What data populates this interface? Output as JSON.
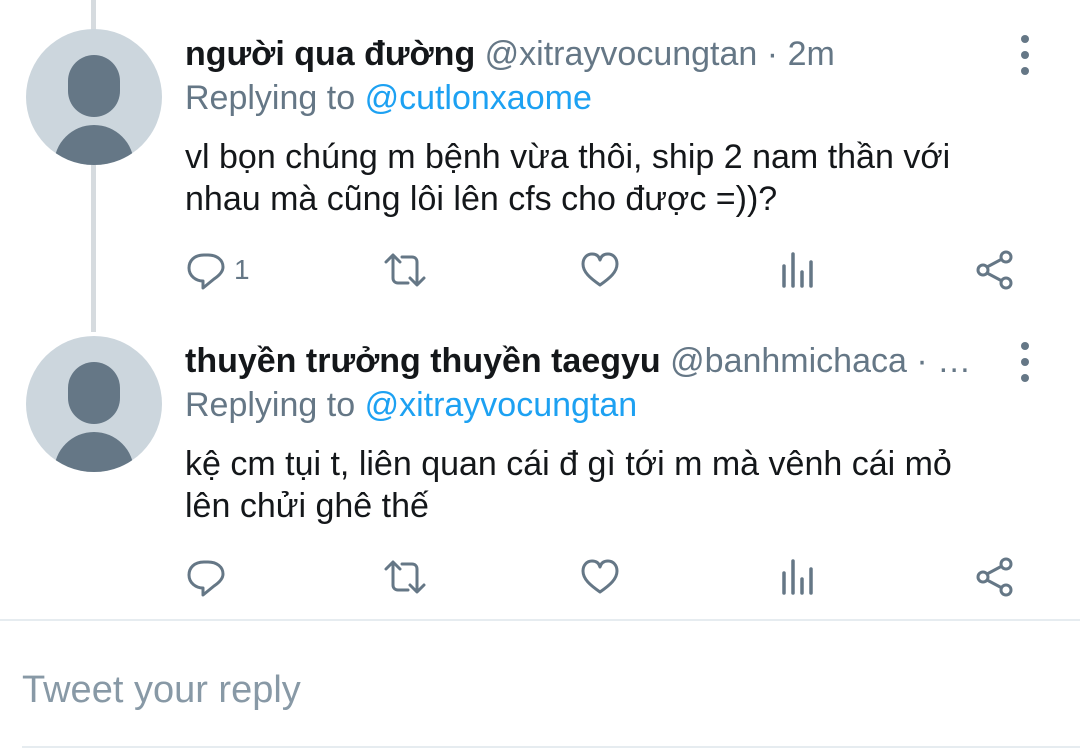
{
  "tweets": [
    {
      "display_name": "người qua đường",
      "handle": "@xitrayvocungtan",
      "separator": "·",
      "time": "2m",
      "replying_prefix": "Replying to",
      "replying_to": "@cutlonxaome",
      "text_line1": "vl bọn chúng m bệnh vừa thôi, ship 2 nam thần với",
      "text_line2": "nhau mà cũng lôi lên cfs cho được =))?",
      "reply_count": "1",
      "icons": [
        "reply-icon",
        "retweet-icon",
        "like-icon",
        "analytics-icon",
        "share-icon",
        "more-icon"
      ]
    },
    {
      "display_name": "thuyền trưởng thuyền taegyu",
      "handle": "@banhmichaca",
      "separator": "· …",
      "time": "",
      "replying_prefix": "Replying to",
      "replying_to": "@xitrayvocungtan",
      "text_line1": "kệ cm tụi t, liên quan cái đ gì tới m mà vênh cái mỏ",
      "text_line2": "lên chửi ghê thế",
      "reply_count": "",
      "icons": [
        "reply-icon",
        "retweet-icon",
        "like-icon",
        "analytics-icon",
        "share-icon",
        "more-icon"
      ]
    }
  ],
  "composer": {
    "placeholder": "Tweet your reply"
  },
  "colors": {
    "primary_text": "#14171a",
    "secondary_text": "#657786",
    "mention": "#1da1f2",
    "avatar_bg": "#ccd6dd",
    "thread_line": "#d6dbdf"
  }
}
